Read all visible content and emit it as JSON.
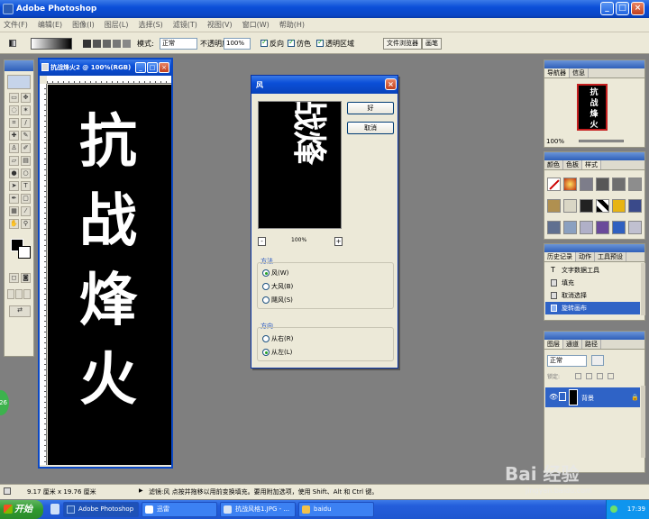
{
  "app": {
    "title": "Adobe Photoshop"
  },
  "menu": [
    "文件(F)",
    "编辑(E)",
    "图像(I)",
    "图层(L)",
    "选择(S)",
    "滤镜(T)",
    "视图(V)",
    "窗口(W)",
    "帮助(H)"
  ],
  "options": {
    "mode_label": "模式:",
    "mode_value": "正常",
    "opacity_label": "不透明度:",
    "opacity_value": "100%",
    "reverse_label": "反向",
    "dither_label": "仿色",
    "transparency_label": "透明区域",
    "file_browser_tab": "文件浏览器",
    "brushes_tab": "画笔"
  },
  "document": {
    "title": "抗战烽火2 @ 100%(RGB)",
    "canvas_text": "抗战烽火"
  },
  "dialog": {
    "title": "风",
    "ok_label": "好",
    "cancel_label": "取消",
    "preview_text": "战烽",
    "zoom": "100%",
    "zoom_minus": "-",
    "zoom_plus": "+",
    "method_label": "方法",
    "methods": [
      "风(W)",
      "大风(B)",
      "飓风(S)"
    ],
    "direction_label": "方向",
    "directions": [
      "从右(R)",
      "从左(L)"
    ]
  },
  "navigator": {
    "tabs": [
      "导航器",
      "信息"
    ],
    "zoom": "100%",
    "thumb_text": "抗战烽火"
  },
  "styles_palette": {
    "tabs": [
      "颜色",
      "色板",
      "样式"
    ]
  },
  "history": {
    "tabs": [
      "历史记录",
      "动作",
      "工具预设"
    ],
    "items": [
      "文字数据工具",
      "填充",
      "取消选择",
      "旋转画布"
    ]
  },
  "layers": {
    "tabs": [
      "图层",
      "通道",
      "路径"
    ],
    "blend": "正常",
    "lock_label": "锁定:",
    "layer_name": "背景"
  },
  "status": {
    "doc_size": "9.17 厘米 x 19.76 厘米",
    "hint": "滤镜:风   点按并拖移以用前变换填充。要用附加选项，使用 Shift、Alt 和 Ctrl 键。"
  },
  "taskbar": {
    "start": "开始",
    "tasks": [
      "Adobe Photoshop",
      "迅雷",
      "抗战风格1.JPG - ...",
      "baidu"
    ],
    "time": "17:39"
  },
  "badge": "26",
  "watermark": {
    "logo": "Bai 经验",
    "url": "jingyan.baidu.com"
  },
  "colors": {
    "titlebar": "#0b4fd8",
    "canvas": "#000000",
    "chrome": "#ece9d8"
  }
}
